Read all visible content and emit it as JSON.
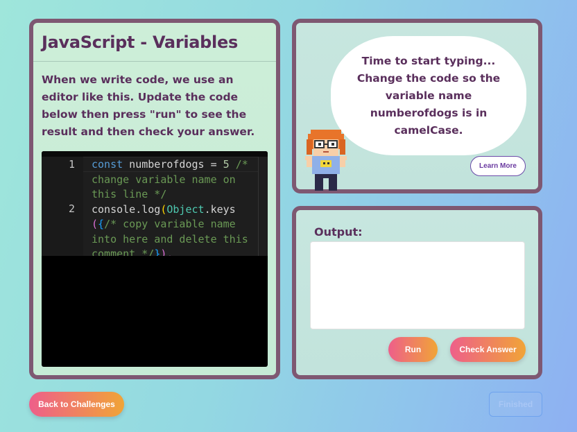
{
  "lesson": {
    "title": "JavaScript - Variables",
    "intro": "When we write code, we use an editor like this. Update the code below then press \"run\" to see the result and then check your answer."
  },
  "editor": {
    "line_numbers": [
      "1",
      "2"
    ],
    "line1": {
      "keyword": "const",
      "text": " numberofdogs = ",
      "number": "5",
      "comment": " /* change variable name on this line */"
    },
    "line2": {
      "prefix": "console.log",
      "open_paren": "(",
      "object": "Object",
      "method": ".keys",
      "open_paren2": "(",
      "open_brace": "{",
      "comment": "/* copy variable name into here and delete this comment */",
      "close_brace": "}",
      "close": ")."
    }
  },
  "instructions": {
    "bubble_text": "Time to start typing... Change the code so the variable name numberofdogs is in camelCase.",
    "learn_more": "Learn More"
  },
  "output": {
    "label": "Output:",
    "value": ""
  },
  "buttons": {
    "run": "Run",
    "check": "Check Answer",
    "back": "Back to Challenges",
    "finished": "Finished"
  },
  "colors": {
    "panel_border": "#7e5872",
    "title_text": "#5a2f5c",
    "button_gradient_start": "#ee5f8a",
    "button_gradient_end": "#f0a437",
    "finished_border": "#6ea3ee"
  }
}
